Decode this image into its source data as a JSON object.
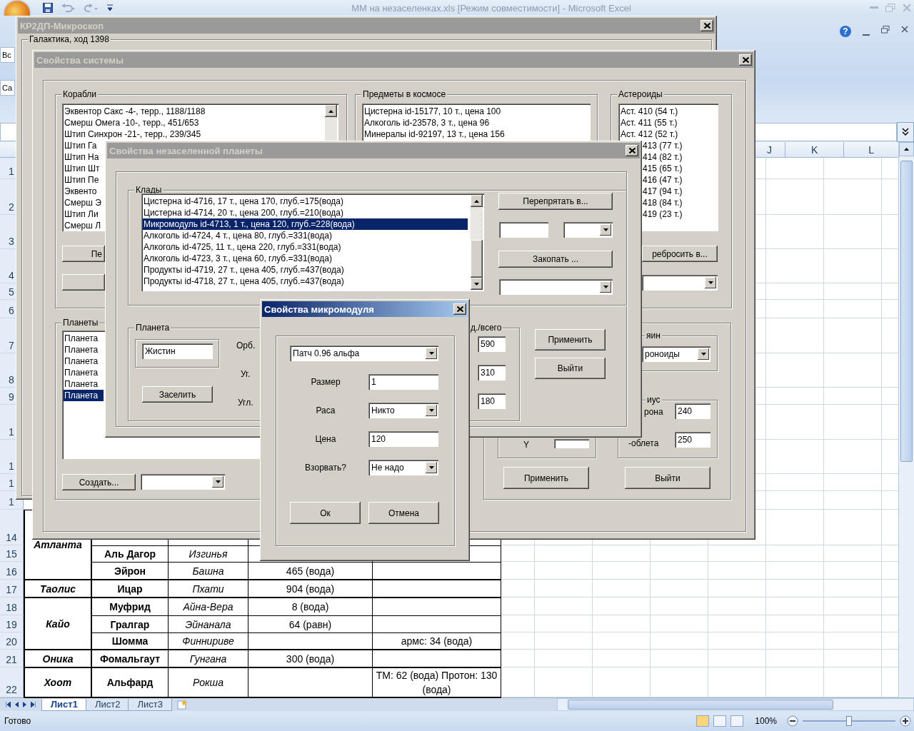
{
  "excel": {
    "title": "ММ на незаселенках.xls  [Режим совместимости]  -  Microsoft Excel",
    "help": "?",
    "ribbon_fragments": [
      "Вс",
      "Ca"
    ],
    "column_headers": [
      "J",
      "K",
      "L"
    ],
    "row_headers": [
      "1",
      "2",
      "3",
      "4",
      "5",
      "6",
      "7",
      "8",
      "9",
      "1",
      "1",
      "1",
      "1",
      "14",
      "15",
      "16",
      "17",
      "18",
      "19",
      "20",
      "21",
      "22"
    ],
    "table": [
      {
        "column_1": "Атланта",
        "rows": [
          {},
          {
            "column_2": "Аль Дагор",
            "column_3": "Изгинья"
          },
          {
            "column_2": "Эйрон",
            "column_3": "Башна",
            "column_4": "465 (вода)"
          }
        ]
      },
      {
        "column_1": "Таолис",
        "rows": [
          {
            "column_2": "Ицар",
            "column_3": "Пхати",
            "column_4": "904 (вода)"
          }
        ]
      },
      {
        "column_1": "Кайо",
        "rows": [
          {
            "column_2": "Муфрид",
            "column_3": "Айна-Вера",
            "column_4": "8 (вода)"
          },
          {
            "column_2": "Гралгар",
            "column_3": "Эйнанала",
            "column_4": "64 (равн)"
          },
          {
            "column_2": "Шомма",
            "column_3": "Финнириве",
            "column_5": "армс: 34 (вода)"
          }
        ]
      },
      {
        "column_1": "Оника",
        "rows": [
          {
            "column_2": "Фомальгаут",
            "column_3": "Гунгана",
            "column_4": "300 (вода)"
          }
        ]
      },
      {
        "column_1": "Хоот",
        "rows": [
          {
            "column_2": "Альфард",
            "column_3": "Рокша",
            "column_5": "ТМ: 62 (вода) Протон: 130 (вода)"
          }
        ]
      }
    ],
    "sheet_tabs": [
      {
        "label": "Лист1",
        "selected": true
      },
      {
        "label": "Лист2",
        "selected": false
      },
      {
        "label": "Лист3",
        "selected": false
      }
    ],
    "status": "Готово",
    "zoom": {
      "reading": "100%",
      "level": 0.5
    }
  },
  "microscope_window": {
    "title": "КР2ДП-Микроскоп",
    "active": false,
    "group": "Галактика, ход 1398"
  },
  "system_window": {
    "title": "Свойства системы",
    "active": false,
    "ships": {
      "label": "Корабли",
      "items": [
        {
          "text": "Эквентор Сакс -4-, терр., 1188/1188",
          "selected": false
        },
        {
          "text": "Смерш Омега -10-, терр., 451/653",
          "selected": false
        },
        {
          "text": "Штип Синхрон -21-, терр., 239/345",
          "selected": false
        },
        {
          "text": "Штип Га",
          "selected": false
        },
        {
          "text": "Штип На",
          "selected": false
        },
        {
          "text": "Штип Шт",
          "selected": false
        },
        {
          "text": "Штип Пе",
          "selected": false
        },
        {
          "text": "Эквенто",
          "selected": false
        },
        {
          "text": "Смерш Э",
          "selected": false
        },
        {
          "text": "Штип Ли",
          "selected": false
        },
        {
          "text": "Смерш Л",
          "selected": false
        }
      ]
    },
    "ship_button": "Пе",
    "space_items": {
      "label": "Предметы в космосе",
      "items": [
        {
          "text": "Цистерна id-15177, 10 т., цена 100",
          "selected": false
        },
        {
          "text": "Алкоголь id-23578, 3 т., цена 96",
          "selected": false
        },
        {
          "text": "Минералы id-92197, 13 т., цена 156",
          "selected": false
        }
      ]
    },
    "asteroids": {
      "label": "Астероиды",
      "items": [
        {
          "text": "Аст. 410 (54 т.)",
          "selected": false
        },
        {
          "text": "Аст. 411 (55 т.)",
          "selected": false
        },
        {
          "text": "Аст. 412 (52 т.)",
          "selected": false
        },
        {
          "text": "413 (77 т.)",
          "selected": false
        },
        {
          "text": "414 (82 т.)",
          "selected": false
        },
        {
          "text": "415 (65 т.)",
          "selected": false
        },
        {
          "text": "416 (47 т.)",
          "selected": false
        },
        {
          "text": "417 (94 т.)",
          "selected": false
        },
        {
          "text": "418 (84 т.)",
          "selected": false
        },
        {
          "text": "419 (23 т.)",
          "selected": false
        }
      ]
    },
    "asteroid_button": "ребросить в...",
    "planets": {
      "label": "Планеты",
      "items": [
        {
          "text": "Планета",
          "selected": false
        },
        {
          "text": "Планета",
          "selected": false
        },
        {
          "text": "Планета",
          "selected": false
        },
        {
          "text": "Планета",
          "selected": false
        },
        {
          "text": "Планета",
          "selected": false
        },
        {
          "text": "Планета",
          "selected": true
        }
      ]
    },
    "create_button": "Создать...",
    "owner": {
      "label": "яин",
      "value": "роноиды"
    },
    "radius": {
      "label": "иус",
      "rows": [
        {
          "label": "рона",
          "value": "240"
        },
        {
          "label": "-облета",
          "value": "250"
        }
      ]
    },
    "position": {
      "label": "Y"
    },
    "actions": [
      "Применить",
      "Выйти"
    ]
  },
  "planet_window": {
    "title": "Свойства незаселенной планеты",
    "active": false,
    "treasures": {
      "label": "Клады",
      "items": [
        {
          "text": "Цистерна id-4716, 17 т., цена 170, глуб.=175(вода)",
          "selected": false
        },
        {
          "text": "Цистерна id-4714, 20 т., цена 200, глуб.=210(вода)",
          "selected": false
        },
        {
          "text": "Микромодуль id-4713, 1 т., цена 120, глуб.=228(вода)",
          "selected": true
        },
        {
          "text": "Алкоголь id-4724, 4 т., цена 80, глуб.=331(вода)",
          "selected": false
        },
        {
          "text": "Алкоголь id-4725, 11 т., цена 220, глуб.=331(вода)",
          "selected": false
        },
        {
          "text": "Алкоголь id-4723, 3 т., цена 60, глуб.=331(вода)",
          "selected": false
        },
        {
          "text": "Продукты id-4719, 27 т., цена 405, глуб.=437(вода)",
          "selected": false
        },
        {
          "text": "Продукты id-4718, 27 т., цена 405, глуб.=437(вода)",
          "selected": false
        }
      ]
    },
    "buttons": [
      "Перепрятать в...",
      "Закопать ..."
    ],
    "planet": {
      "label": "Планета",
      "name": "Жистин",
      "button": "Заселить",
      "labels": [
        "Орб.",
        "Уг.",
        "Угл."
      ]
    },
    "totals": {
      "label": "д./всего",
      "values": [
        "590",
        "310",
        "180"
      ]
    },
    "actions": [
      "Применить",
      "Выйти"
    ]
  },
  "module_window": {
    "title": "Свойства микромодуля",
    "active": true,
    "patch": "Патч 0.96 альфа",
    "rows": [
      {
        "kind": "field",
        "label": "Размер",
        "value": "1"
      },
      {
        "kind": "dropdown",
        "label": "Раса",
        "value": "Никто"
      },
      {
        "kind": "field",
        "label": "Цена",
        "value": "120"
      },
      {
        "kind": "dropdown",
        "label": "Взорвать?",
        "value": "Не надо"
      }
    ],
    "buttons": [
      "Ок",
      "Отмена"
    ]
  }
}
